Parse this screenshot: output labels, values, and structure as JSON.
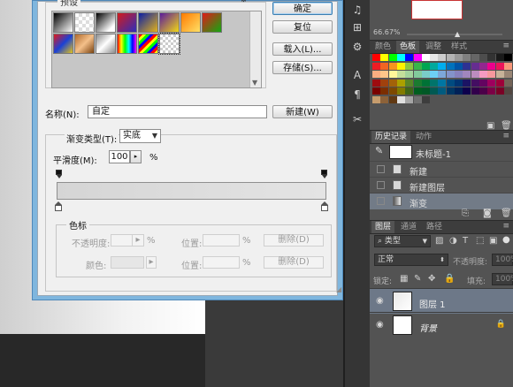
{
  "dialog": {
    "presets_title": "预设",
    "presets_gear": "⚙",
    "buttons": {
      "ok": "确定",
      "reset": "复位",
      "load": "载入(L)...",
      "save": "存储(S)...",
      "new": "新建(W)"
    },
    "name_label": "名称(N):",
    "name_value": "自定",
    "type_label": "渐变类型(T):",
    "type_value": "实底",
    "smooth_label": "平滑度(M):",
    "smooth_value": "100",
    "smooth_unit": "%",
    "stops_title": "色标",
    "opacity_label": "不透明度:",
    "opacity_unit": "%",
    "location_label": "位置:",
    "location_unit": "%",
    "delete_label": "删除(D)",
    "color_label": "颜色:",
    "swatches": [
      "linear-gradient(135deg,#000,#fff)",
      "repeating-conic-gradient(#ddd 0 25%,#fff 0 50%) 0 0/8px 8px",
      "linear-gradient(135deg,#000,#fff 80%)",
      "linear-gradient(135deg,#d31b1b,#2d2dbd)",
      "linear-gradient(135deg,#0b1fa6,#e2b21a)",
      "linear-gradient(135deg,#5b1a9c,#f2d814)",
      "linear-gradient(135deg,#ff7a00,#ffe066)",
      "linear-gradient(135deg,#e11a1a,#11a811)",
      "linear-gradient(135deg,#e11a1a,#1a41d6,#e2c21a)",
      "linear-gradient(135deg,#b06a2c,#f4c08a,#7a4310)",
      "linear-gradient(135deg,#8c8c8c,#ffffff,#8c8c8c)",
      "linear-gradient(90deg,#f00,#ff0,#0f0,#0ff,#00f,#f0f)",
      "repeating-linear-gradient(135deg,#f00 0 3px,#ff0 3px 6px,#0f0 6px 9px,#00f 9px 12px)",
      "repeating-conic-gradient(#ccc 0 25%,#fff 0 50%) 0 0/6px 6px"
    ]
  },
  "tools": [
    "♫",
    "A",
    "¶",
    "✂"
  ],
  "navigator": {
    "zoom": "66.67%"
  },
  "swatches_panel": {
    "tabs": [
      "颜色",
      "色板",
      "调整",
      "样式"
    ],
    "colors": [
      "#ff0000",
      "#ffff00",
      "#00ff00",
      "#00ffff",
      "#0000ff",
      "#ff00ff",
      "#ffffff",
      "#e6e6e6",
      "#cccccc",
      "#b3b3b3",
      "#999999",
      "#808080",
      "#666666",
      "#4d4d4d",
      "#333333",
      "#1a1a1a",
      "#000000",
      "#ed1c24",
      "#f26522",
      "#f7941d",
      "#fff200",
      "#8dc63f",
      "#39b54a",
      "#00a651",
      "#00a99d",
      "#00aeef",
      "#0072bc",
      "#0054a6",
      "#2e3192",
      "#662d91",
      "#92278f",
      "#ec008c",
      "#ed145b",
      "#f7977a",
      "#f9ad81",
      "#fdc68a",
      "#fff79a",
      "#c4df9b",
      "#a3d39c",
      "#82ca9c",
      "#7accc8",
      "#6dcff6",
      "#7da7d9",
      "#8393ca",
      "#8781bd",
      "#a187be",
      "#bc8cbf",
      "#f49ac2",
      "#f6989d",
      "#c7b299",
      "#998675",
      "#9e0b0f",
      "#a0410d",
      "#a36209",
      "#aba000",
      "#598527",
      "#1a7b30",
      "#007236",
      "#00746b",
      "#0076a3",
      "#004b80",
      "#003471",
      "#1b1464",
      "#440e62",
      "#630460",
      "#9e005d",
      "#9e0039",
      "#736357",
      "#790000",
      "#7b2e00",
      "#7d4900",
      "#827b00",
      "#406618",
      "#005e20",
      "#005826",
      "#005952",
      "#005b7f",
      "#003663",
      "#002157",
      "#0d004c",
      "#32004b",
      "#4b0049",
      "#7b0046",
      "#7a0026",
      "#534741",
      "#c69c6d",
      "#8c6239",
      "#603913",
      "#e0e0e0",
      "#a6a6a6",
      "#707070",
      "#3d3d3d"
    ]
  },
  "history": {
    "tabs": [
      "历史记录",
      "动作"
    ],
    "snapshot": "未标题-1",
    "items": [
      "新建",
      "新建图层",
      "渐变"
    ]
  },
  "layers": {
    "tabs": [
      "图层",
      "通道",
      "路径"
    ],
    "kind_filter": "类型",
    "blend_mode": "正常",
    "opacity_label": "不透明度:",
    "opacity_value": "100%",
    "lock_label": "锁定:",
    "fill_label": "填充:",
    "fill_value": "100%",
    "items": [
      "图层 1",
      "背景"
    ]
  }
}
